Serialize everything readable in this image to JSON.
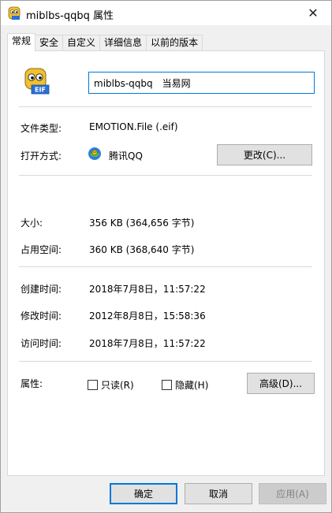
{
  "window": {
    "title": "miblbs-qqbq 属性",
    "close_glyph": "✕"
  },
  "tabs": [
    {
      "label": "常规",
      "active": true
    },
    {
      "label": "安全",
      "active": false
    },
    {
      "label": "自定义",
      "active": false
    },
    {
      "label": "详细信息",
      "active": false
    },
    {
      "label": "以前的版本",
      "active": false
    }
  ],
  "general": {
    "file_name": "miblbs-qqbq　当易网",
    "file_type_label": "文件类型:",
    "file_type_value": "EMOTION.File (.eif)",
    "open_with_label": "打开方式:",
    "open_with_value": "腾讯QQ",
    "change_button": "更改(C)...",
    "size_label": "大小:",
    "size_value": "356 KB (364,656 字节)",
    "disk_size_label": "占用空间:",
    "disk_size_value": "360 KB (368,640 字节)",
    "created_label": "创建时间:",
    "created_value": "2018年7月8日，11:57:22",
    "modified_label": "修改时间:",
    "modified_value": "2012年8月8日，15:58:36",
    "accessed_label": "访问时间:",
    "accessed_value": "2018年7月8日，11:57:22",
    "attributes_label": "属性:",
    "readonly_label": "只读(R)",
    "hidden_label": "隐藏(H)",
    "advanced_button": "高级(D)...",
    "file_icon_text": "EIF"
  },
  "footer": {
    "ok": "确定",
    "cancel": "取消",
    "apply": "应用(A)"
  },
  "colors": {
    "accent": "#0078d7",
    "separator": "#d9d9d9",
    "dialog_bg": "#f0f0f0"
  },
  "icons": {
    "title": "eif-file-icon",
    "file": "eif-file-icon",
    "open_with": "qq-app-icon"
  }
}
